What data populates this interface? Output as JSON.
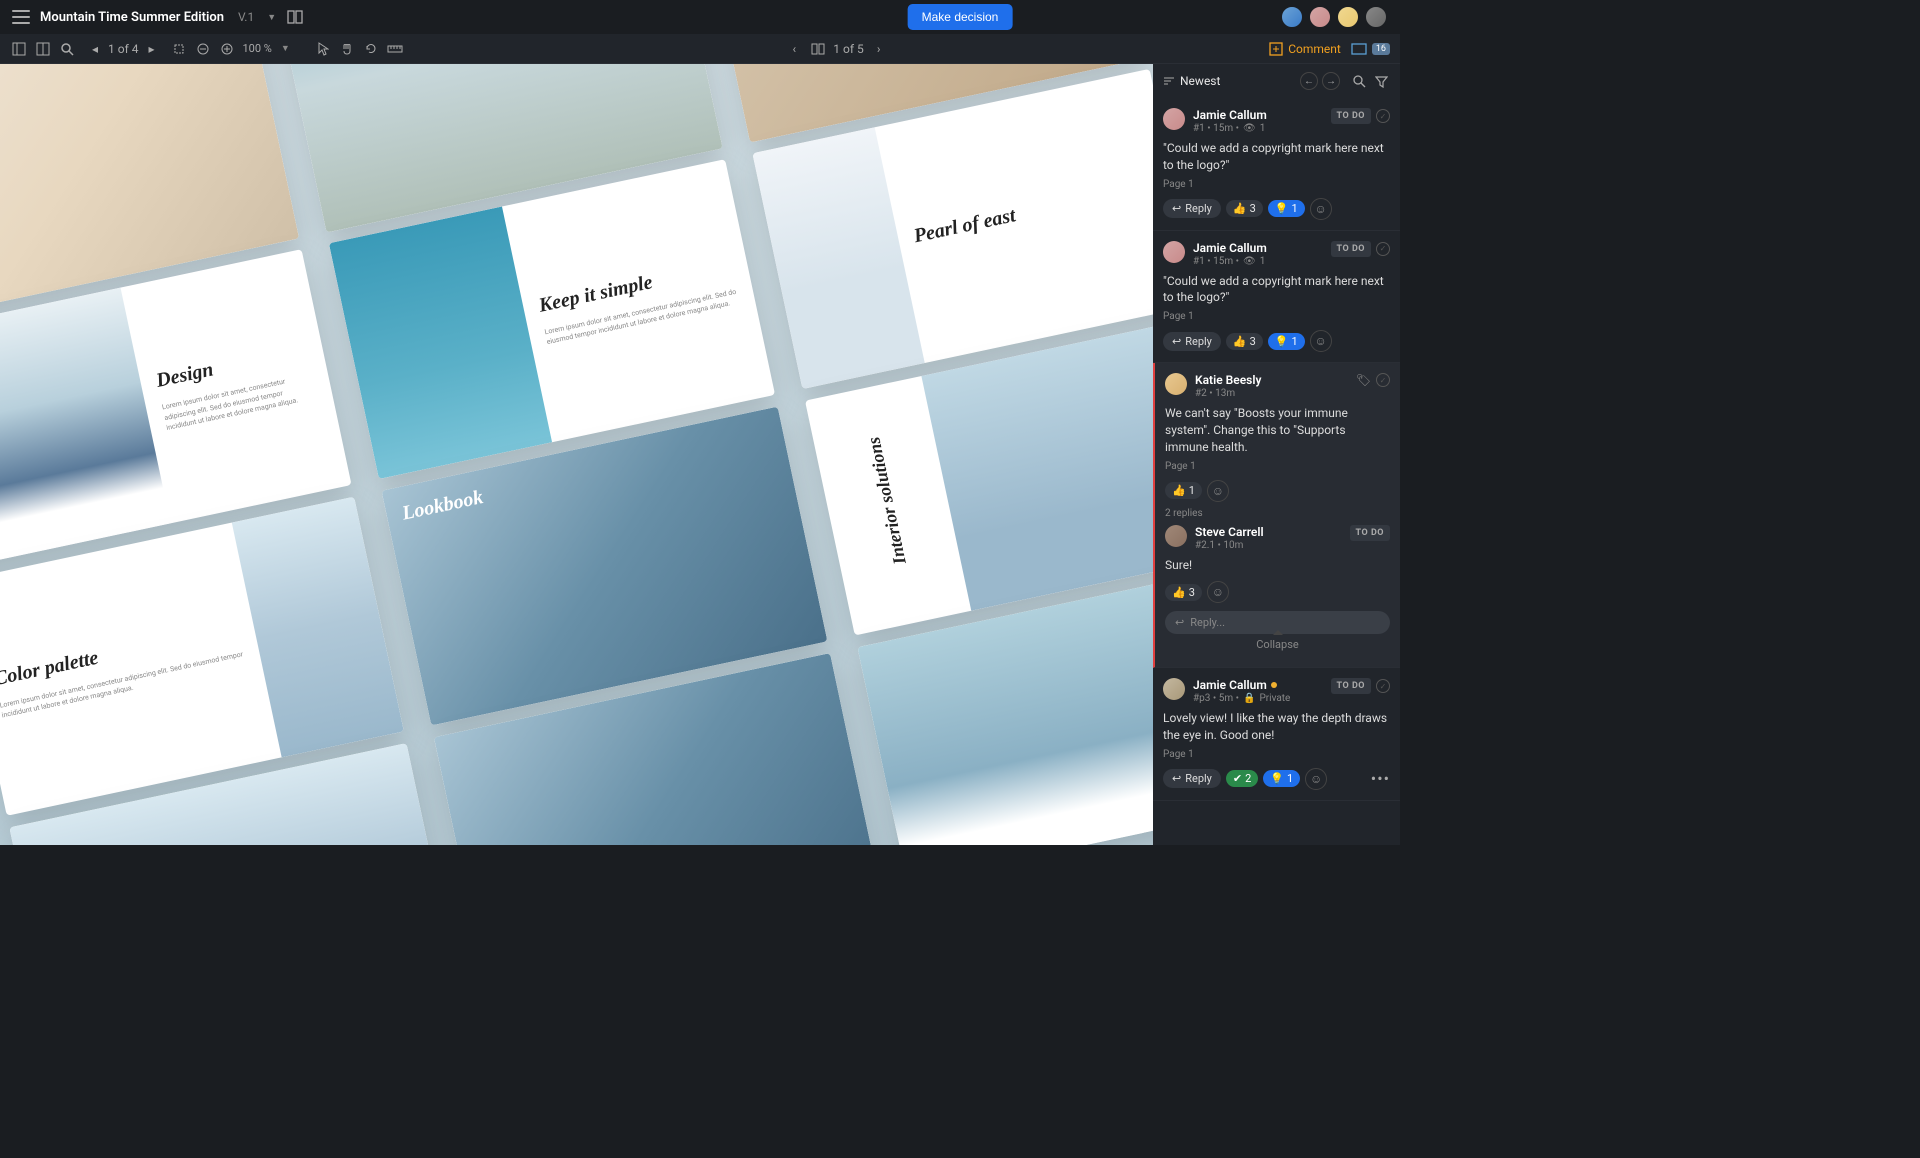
{
  "header": {
    "title": "Mountain Time Summer Edition",
    "version": "V.1",
    "makeDecision": "Make decision"
  },
  "toolbar": {
    "page": "1 of 4",
    "zoom": "100 %",
    "spread": "1 of 5",
    "commentLabel": "Comment",
    "screenCount": "16"
  },
  "panel": {
    "sort": "Newest",
    "collapse": "Collapse",
    "replyPlaceholder": "Reply...",
    "replyBtn": "Reply"
  },
  "cards": {
    "design": "Design",
    "keepSimple": "Keep it simple",
    "pearl": "Pearl of east",
    "palette": "Color palette",
    "lookbook": "Lookbook",
    "interior": "Interior solutions",
    "lorem": "Lorem ipsum dolor sit amet, consectetur adipiscing elit. Sed do eiusmod tempor incididunt ut labore et dolore magna aliqua."
  },
  "comments": [
    {
      "author": "Jamie Callum",
      "meta": "#1 • 15m •",
      "views": "1",
      "status": "TO DO",
      "text": "\"Could we add a copyright mark here next to the logo?\"",
      "page": "Page 1",
      "thumbs": "3",
      "bulb": "1"
    },
    {
      "author": "Jamie Callum",
      "meta": "#1 • 15m •",
      "views": "1",
      "status": "TO DO",
      "text": "\"Could we add a copyright mark here next to the logo?\"",
      "page": "Page 1",
      "thumbs": "3",
      "bulb": "1"
    },
    {
      "author": "Katie Beesly",
      "meta": "#2 • 13m",
      "text": "We can't say \"Boosts your immune system\". Change this to \"Supports immune health.",
      "page": "Page 1",
      "thumbs": "1",
      "repliesCount": "2 replies",
      "reply": {
        "author": "Steve Carrell",
        "meta": "#2.1 • 10m",
        "status": "TO DO",
        "text": "Sure!",
        "thumbs": "3"
      }
    },
    {
      "author": "Jamie Callum",
      "meta": "#p3 • 5m •",
      "privacy": "Private",
      "status": "TO DO",
      "text": "Lovely view! I like the way the depth draws the eye in. Good one!",
      "page": "Page 1",
      "check": "2",
      "bulb": "1"
    }
  ]
}
